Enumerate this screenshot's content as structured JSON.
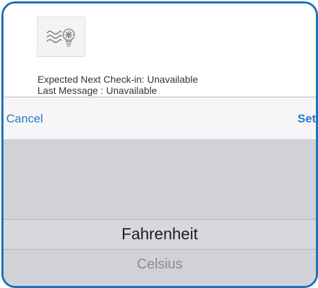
{
  "device": {
    "icon": "wind-lightbulb-icon",
    "expected_next_checkin": "Expected Next Check-in: Unavailable",
    "last_message": "Last Message : Unavailable"
  },
  "picker": {
    "cancel_label": "Cancel",
    "set_label": "Set",
    "options": [
      "Fahrenheit",
      "Celsius"
    ],
    "selected_value": "Fahrenheit"
  },
  "colors": {
    "accent": "#2b78c7",
    "frame_border": "#1c6fb8",
    "wheel_bg": "#d0d2d8"
  }
}
